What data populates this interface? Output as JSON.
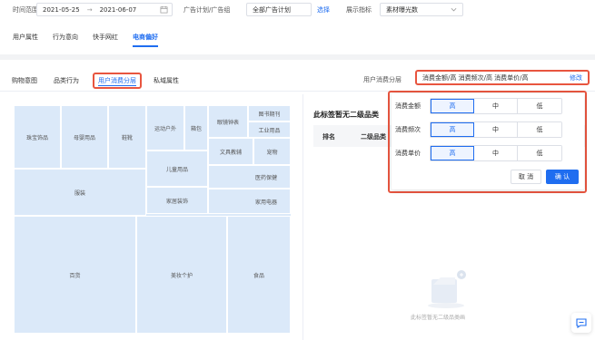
{
  "filters": {
    "time_range_label": "时间范围",
    "date_start": "2021-05-25",
    "date_sep": "→",
    "date_end": "2021-06-07",
    "ad_plan_label": "广告计划/广告组",
    "ad_plan_value": "全部广告计划",
    "select_label": "选择",
    "metric_label": "展示指标",
    "metric_value": "素材曝光数"
  },
  "main_tabs": [
    "用户属性",
    "行为意向",
    "快手网红",
    "电商偏好"
  ],
  "main_tab_active": "电商偏好",
  "sub_tabs": [
    "购物意图",
    "品类行为",
    "用户消费分层",
    "私域属性"
  ],
  "sub_tab_active": "用户消费分层",
  "consumer_level": {
    "label": "用户消费分层",
    "summary": "消费金额/高 消费频次/高 消费单价/高",
    "edit_label": "修改"
  },
  "treemap": {
    "cells": [
      "珠宝饰品",
      "母婴用品",
      "鞋靴",
      "运动户外",
      "箱包",
      "眼镜钟表",
      "图书期刊",
      "工业用品",
      "文具教辅",
      "宠物",
      "儿童用品",
      "医药保健",
      "服装",
      "家居装饰",
      "家用电器",
      "百货",
      "美妆个护",
      "食品"
    ]
  },
  "right_panel": {
    "title": "此标签暂无二级品类",
    "col_rank": "排名",
    "col_category": "二级品类",
    "empty_text": "此标签暂无二级品类画"
  },
  "popup": {
    "rows": [
      {
        "label": "消费金额",
        "options": [
          "高",
          "中",
          "低"
        ],
        "selected": "高"
      },
      {
        "label": "消费频次",
        "options": [
          "高",
          "中",
          "低"
        ],
        "selected": "高"
      },
      {
        "label": "消费单价",
        "options": [
          "高",
          "中",
          "低"
        ],
        "selected": "高"
      }
    ],
    "cancel_label": "取 消",
    "ok_label": "确 认"
  },
  "colors": {
    "accent": "#1f6df0",
    "highlight_outline": "#e8553f",
    "treemap_fill": "#dbe9f9"
  }
}
